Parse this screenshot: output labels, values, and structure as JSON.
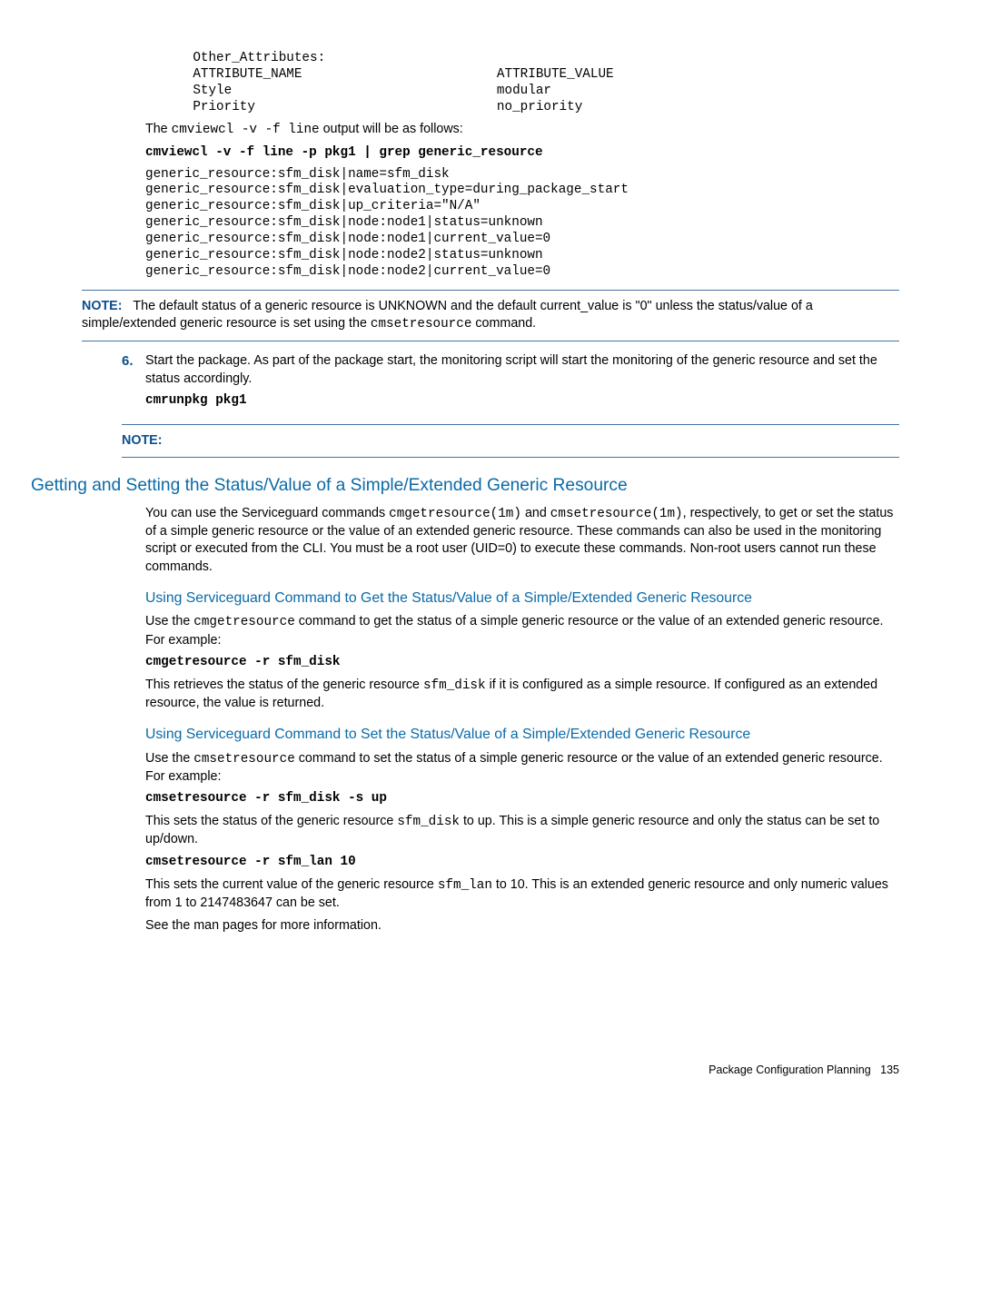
{
  "code": {
    "attrs": "    Other_Attributes:\n    ATTRIBUTE_NAME                         ATTRIBUTE_VALUE\n    Style                                  modular\n    Priority                               no_priority",
    "cmviewcl_intro_pre": "The ",
    "cmviewcl_intro_cmd": "cmviewcl -v -f line",
    "cmviewcl_intro_post": " output will be as follows:",
    "cmviewcl_cmd": "cmviewcl -v -f line -p pkg1 | grep generic_resource",
    "cmviewcl_out": "generic_resource:sfm_disk|name=sfm_disk\ngeneric_resource:sfm_disk|evaluation_type=during_package_start\ngeneric_resource:sfm_disk|up_criteria=\"N/A\"\ngeneric_resource:sfm_disk|node:node1|status=unknown\ngeneric_resource:sfm_disk|node:node1|current_value=0\ngeneric_resource:sfm_disk|node:node2|status=unknown\ngeneric_resource:sfm_disk|node:node2|current_value=0"
  },
  "note1": {
    "label": "NOTE:",
    "text1": "The default status of a generic resource is UNKNOWN and the default current_value is \"0\" unless the status/value of a simple/extended generic resource is set using the ",
    "cmd": "cmsetresource",
    "text2": " command."
  },
  "step6": {
    "num": "6.",
    "text": "Start the package. As part of the package start, the monitoring script will start the monitoring of the generic resource and set the status accordingly.",
    "cmd": "cmrunpkg pkg1"
  },
  "note2": {
    "label": "NOTE:"
  },
  "sec": {
    "title": "Getting and Setting the Status/Value of a Simple/Extended Generic Resource",
    "p1a": "You can use the Serviceguard commands ",
    "p1b": "cmgetresource(1m)",
    "p1c": " and ",
    "p1d": "cmsetresource(1m)",
    "p1e": ", respectively, to get or set the status of a simple generic resource or the value of an extended generic resource. These commands can also be used in the monitoring script or executed from the CLI. You must be a root user (UID=0) to execute these commands. Non-root users cannot run these commands."
  },
  "sub1": {
    "title": "Using Serviceguard Command to Get the Status/Value of a Simple/Extended Generic Resource",
    "p1a": "Use the ",
    "p1b": "cmgetresource",
    "p1c": " command to get the status of a simple generic resource or the value of an extended generic resource. For example:",
    "cmd": "cmgetresource -r sfm_disk",
    "p2a": "This retrieves the status of the generic resource ",
    "p2b": "sfm_disk",
    "p2c": " if it is configured as a simple resource. If configured as an extended resource, the value is returned."
  },
  "sub2": {
    "title": "Using Serviceguard Command to Set the Status/Value of a Simple/Extended Generic Resource",
    "p1a": "Use the ",
    "p1b": "cmsetresource",
    "p1c": " command to set the status of a simple generic resource or the value of an extended generic resource. For example:",
    "cmd1": "cmsetresource -r sfm_disk -s up",
    "p2a": "This sets the status of the generic resource ",
    "p2b": "sfm_disk",
    "p2c": " to up. This is a simple generic resource and only the status can be set to up/down.",
    "cmd2": "cmsetresource -r sfm_lan 10",
    "p3a": "This sets the current value of the generic resource ",
    "p3b": "sfm_lan",
    "p3c": " to 10. This is an extended generic resource and only numeric values from 1 to 2147483647 can be set.",
    "p4": "See the man pages for more information."
  },
  "footer": {
    "text": "Package Configuration Planning",
    "page": "135"
  }
}
